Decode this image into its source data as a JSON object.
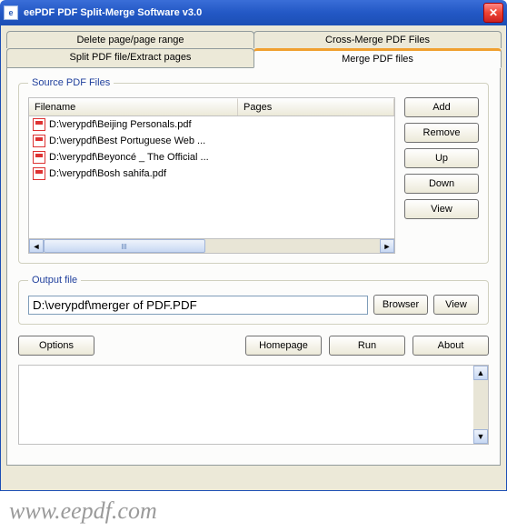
{
  "window": {
    "title": "eePDF PDF Split-Merge Software v3.0"
  },
  "tabs": {
    "row1": [
      {
        "label": "Delete page/page range"
      },
      {
        "label": "Cross-Merge PDF Files"
      }
    ],
    "row2": [
      {
        "label": "Split PDF file/Extract pages"
      },
      {
        "label": "Merge PDF files",
        "active": true
      }
    ]
  },
  "source": {
    "legend": "Source PDF Files",
    "columns": {
      "filename": "Filename",
      "pages": "Pages"
    },
    "files": [
      {
        "name": "D:\\verypdf\\Beijing Personals.pdf"
      },
      {
        "name": "D:\\verypdf\\Best Portuguese Web ..."
      },
      {
        "name": "D:\\verypdf\\Beyoncé _ The Official ..."
      },
      {
        "name": "D:\\verypdf\\Bosh sahifa.pdf"
      }
    ],
    "buttons": {
      "add": "Add",
      "remove": "Remove",
      "up": "Up",
      "down": "Down",
      "view": "View"
    }
  },
  "output": {
    "legend": "Output file",
    "path": "D:\\verypdf\\merger of PDF.PDF",
    "browser": "Browser",
    "view": "View"
  },
  "bottom": {
    "options": "Options",
    "homepage": "Homepage",
    "run": "Run",
    "about": "About"
  },
  "watermark": "www.eepdf.com"
}
